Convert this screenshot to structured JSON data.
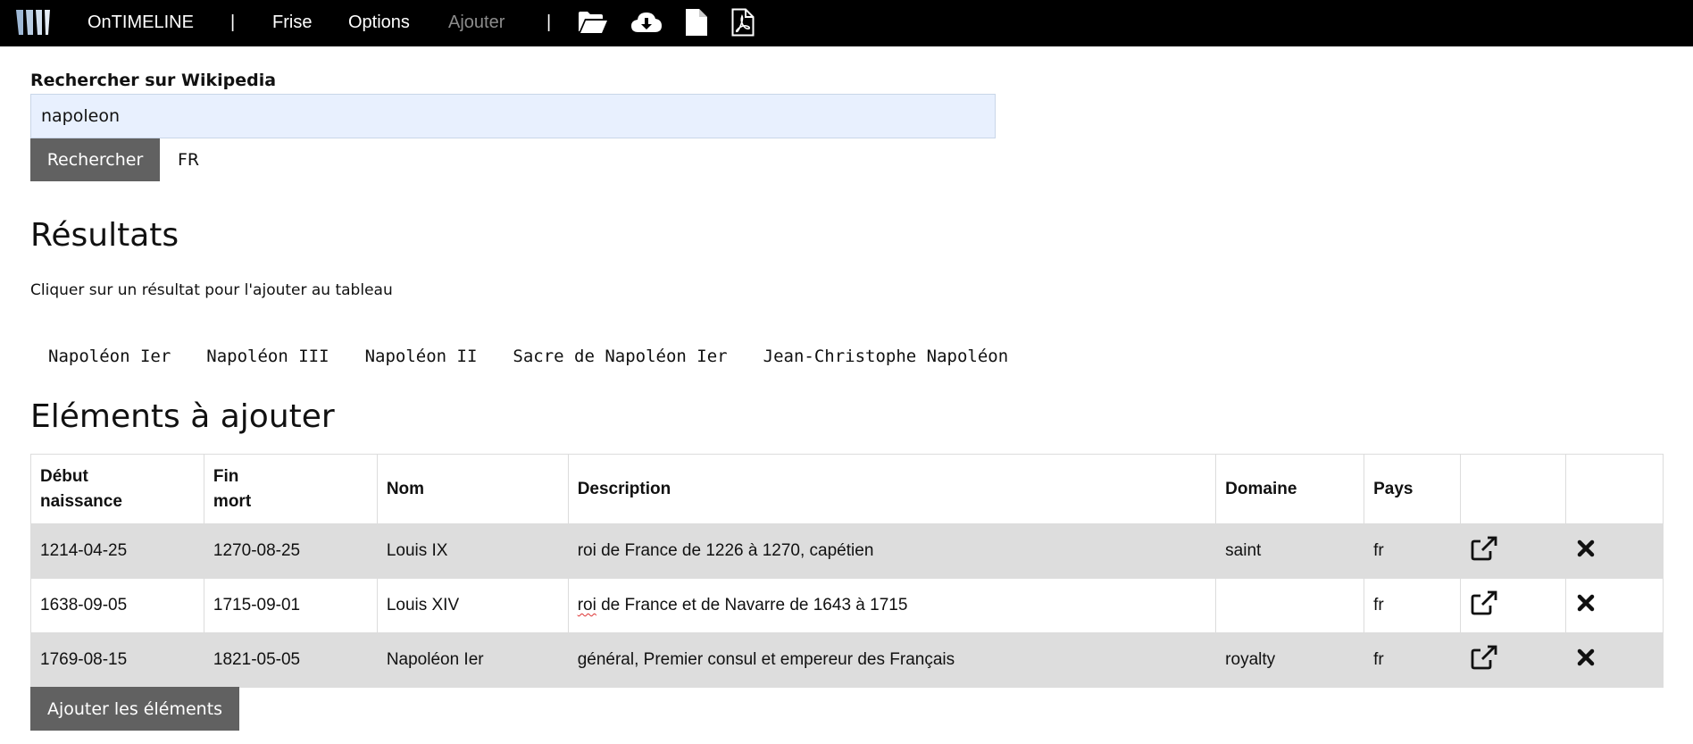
{
  "app": {
    "brand": "OnTIMELINE",
    "nav": [
      {
        "label": "Frise"
      },
      {
        "label": "Options"
      },
      {
        "label": "Ajouter"
      }
    ],
    "separator": "|",
    "toolbar_icons": [
      "folder-open-icon",
      "cloud-download-icon",
      "file-icon",
      "file-pdf-icon"
    ],
    "colors": {
      "topbar": "#000000",
      "button": "#616161",
      "input_bg": "#e8f0fe",
      "row_shade": "#dddddd",
      "disabled_nav": "#8c8c8c"
    }
  },
  "search": {
    "label": "Rechercher sur Wikipedia",
    "value": "napoleon",
    "button": "Rechercher",
    "lang": "FR"
  },
  "results": {
    "title": "Résultats",
    "hint": "Cliquer sur un résultat pour l'ajouter au tableau",
    "items": [
      "Napoléon Ier",
      "Napoléon III",
      "Napoléon II",
      "Sacre de Napoléon Ier",
      "Jean-Christophe Napoléon"
    ]
  },
  "elements": {
    "title": "Eléments à ajouter",
    "columns": {
      "start_line1": "Début",
      "start_line2": "naissance",
      "end_line1": "Fin",
      "end_line2": "mort",
      "name": "Nom",
      "description": "Description",
      "domain": "Domaine",
      "country": "Pays"
    },
    "rows": [
      {
        "start": "1214-04-25",
        "end": "1270-08-25",
        "name": "Louis IX",
        "desc_a": "",
        "desc_b": "roi de France de 1226 à 1270, capétien",
        "domain": "saint",
        "country": "fr"
      },
      {
        "start": "1638-09-05",
        "end": "1715-09-01",
        "name": "Louis XIV",
        "desc_a": "roi",
        "desc_b": " de France et de Navarre de 1643 à 1715",
        "domain": "",
        "country": "fr"
      },
      {
        "start": "1769-08-15",
        "end": "1821-05-05",
        "name": "Napoléon Ier",
        "desc_a": "",
        "desc_b": "général, Premier consul et empereur des Français",
        "domain": "royalty",
        "country": "fr"
      }
    ],
    "add_button": "Ajouter les éléments"
  }
}
